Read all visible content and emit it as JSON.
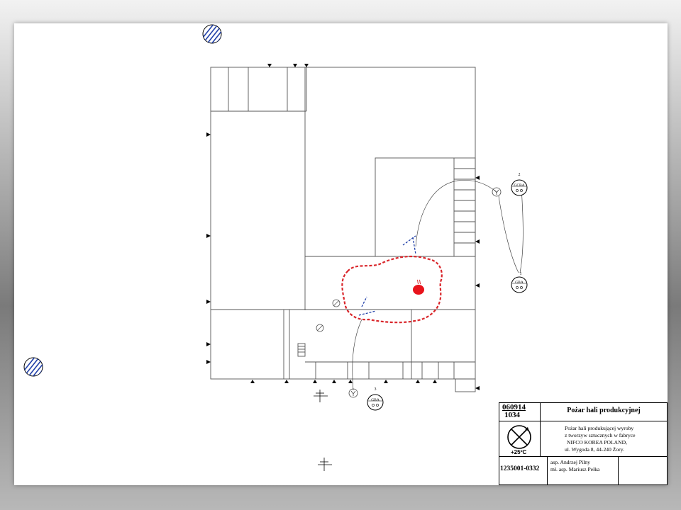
{
  "title_block": {
    "date_code": "060914",
    "time_code": "1034",
    "title": "Pożar hali produkcyjnej",
    "description_lines": [
      "Pożar hali produkującej wyroby",
      "z tworzyw sztucznych w fabryce",
      "NIFCO KOREA POLAND,",
      "ul. Wygoda 8, 44-240 Żory."
    ],
    "temperature": "+25ºC",
    "doc_number": "1235001-0332",
    "authors": [
      "asp. Andrzej Pilny",
      "mł. asp. Mariusz Pełka"
    ]
  },
  "vehicles": [
    {
      "number": "2",
      "label": "GCBA"
    },
    {
      "number": "1",
      "label": "GBA"
    },
    {
      "number": "3",
      "label": "GBA"
    }
  ],
  "colors": {
    "fire_zone": "#d9262b",
    "hose_nozzle": "#1f3fa8",
    "walls": "#555555",
    "sheet": "#ffffff"
  },
  "icons": [
    "hydrant-icon",
    "fire-icon",
    "nozzle-icon",
    "north-arrow-icon",
    "wind-direction-icon"
  ]
}
